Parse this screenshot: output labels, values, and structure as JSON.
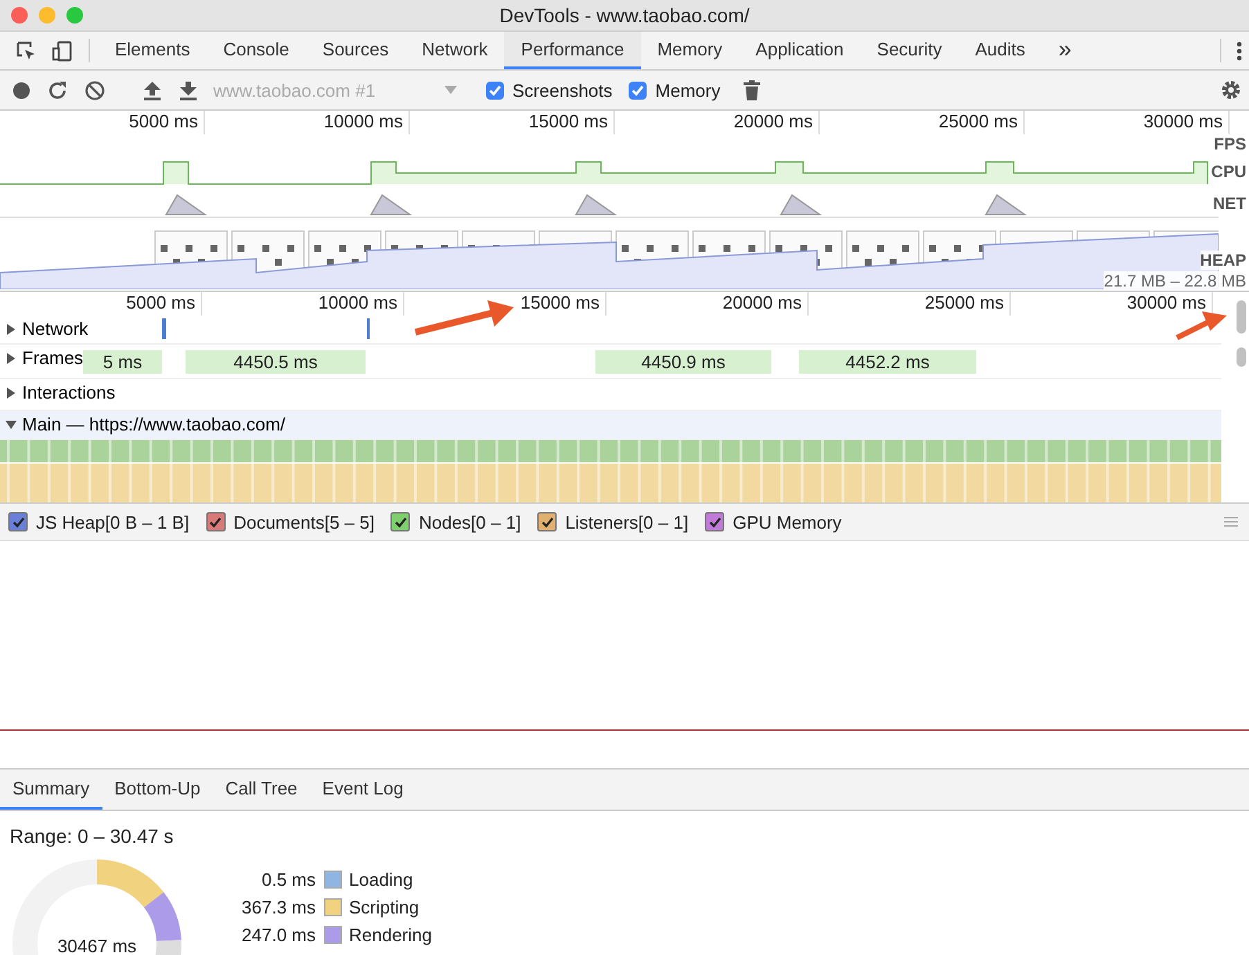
{
  "window": {
    "title": "DevTools - www.taobao.com/"
  },
  "tabs": [
    {
      "label": "Elements",
      "selected": false
    },
    {
      "label": "Console",
      "selected": false
    },
    {
      "label": "Sources",
      "selected": false
    },
    {
      "label": "Network",
      "selected": false
    },
    {
      "label": "Performance",
      "selected": true
    },
    {
      "label": "Memory",
      "selected": false
    },
    {
      "label": "Application",
      "selected": false
    },
    {
      "label": "Security",
      "selected": false
    },
    {
      "label": "Audits",
      "selected": false
    }
  ],
  "overflow": "»",
  "toolbar": {
    "recording": "www.taobao.com #1",
    "options": [
      {
        "label": "Screenshots",
        "checked": true
      },
      {
        "label": "Memory",
        "checked": true
      }
    ]
  },
  "overview": {
    "ticks": [
      "5000 ms",
      "10000 ms",
      "15000 ms",
      "20000 ms",
      "25000 ms",
      "30000 ms"
    ],
    "tracks": [
      "FPS",
      "CPU",
      "NET",
      "HEAP"
    ],
    "heap_range": "21.7 MB – 22.8 MB"
  },
  "timeline": {
    "ticks": [
      "5000 ms",
      "10000 ms",
      "15000 ms",
      "20000 ms",
      "25000 ms",
      "30000 ms"
    ],
    "tracks": [
      {
        "label": "Network",
        "expanded": false
      },
      {
        "label": "Frames",
        "expanded": false,
        "frames": [
          "5 ms",
          "4450.5 ms",
          "4450.9 ms",
          "4452.2 ms"
        ]
      },
      {
        "label": "Interactions",
        "expanded": false
      },
      {
        "label": "Main — https://www.taobao.com/",
        "expanded": true
      }
    ]
  },
  "counters": [
    {
      "label": "JS Heap[0 B – 1 B]",
      "checked": true,
      "color": "#6a7fd8"
    },
    {
      "label": "Documents[5 – 5]",
      "checked": true,
      "color": "#d87a7a"
    },
    {
      "label": "Nodes[0 – 1]",
      "checked": true,
      "color": "#7fcf6f"
    },
    {
      "label": "Listeners[0 – 1]",
      "checked": true,
      "color": "#e0b070"
    },
    {
      "label": "GPU Memory",
      "checked": true,
      "color": "#c07ad8"
    }
  ],
  "bottom_tabs": [
    {
      "label": "Summary",
      "selected": true
    },
    {
      "label": "Bottom-Up",
      "selected": false
    },
    {
      "label": "Call Tree",
      "selected": false
    },
    {
      "label": "Event Log",
      "selected": false
    }
  ],
  "summary": {
    "range": "Range: 0 – 30.47 s",
    "total": "30467 ms",
    "items": [
      {
        "value": "0.5 ms",
        "label": "Loading",
        "color": "#8fb5e3"
      },
      {
        "value": "367.3 ms",
        "label": "Scripting",
        "color": "#f1d27e"
      },
      {
        "value": "247.0 ms",
        "label": "Rendering",
        "color": "#ab9be8"
      }
    ]
  }
}
